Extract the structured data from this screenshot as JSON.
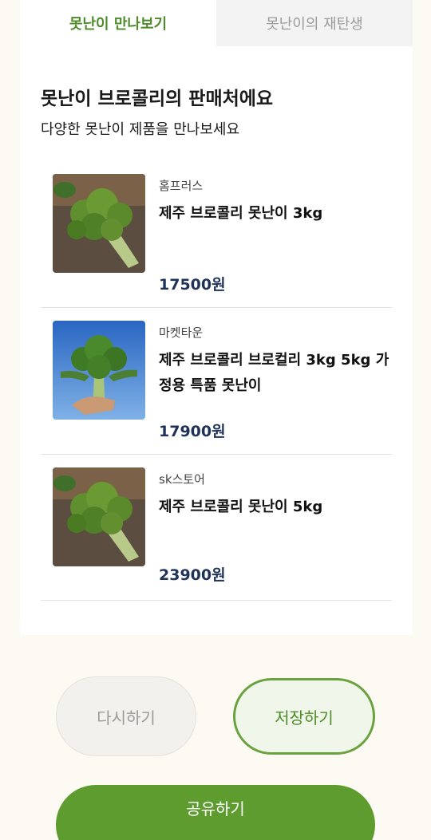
{
  "tabs": [
    {
      "label": "못난이 만나보기",
      "active": true
    },
    {
      "label": "못난이의 재탄생",
      "active": false
    }
  ],
  "section": {
    "title": "못난이 브로콜리의 판매처에요",
    "subtitle": "다양한 못난이 제품을 만나보세요"
  },
  "products": [
    {
      "store": "홈프러스",
      "name": "제주 브로콜리 못난이 3kg",
      "price": "17500원",
      "image": "broccoli-on-table"
    },
    {
      "store": "마켓타운",
      "name": "제주 브로콜리 브로컬리 3kg 5kg 가정용 특품 못난이",
      "price": "17900원",
      "image": "broccoli-held-in-hand-sky"
    },
    {
      "store": "sk스토어",
      "name": "제주 브로콜리 못난이 5kg",
      "price": "23900원",
      "image": "broccoli-on-table"
    }
  ],
  "buttons": {
    "retry": "다시하기",
    "save": "저장하기",
    "share": "공유하기"
  },
  "colors": {
    "accent": "#5e9c2f",
    "accent_text": "#4e8c2a",
    "price_text": "#1f3258",
    "background": "#fdf9f3"
  }
}
